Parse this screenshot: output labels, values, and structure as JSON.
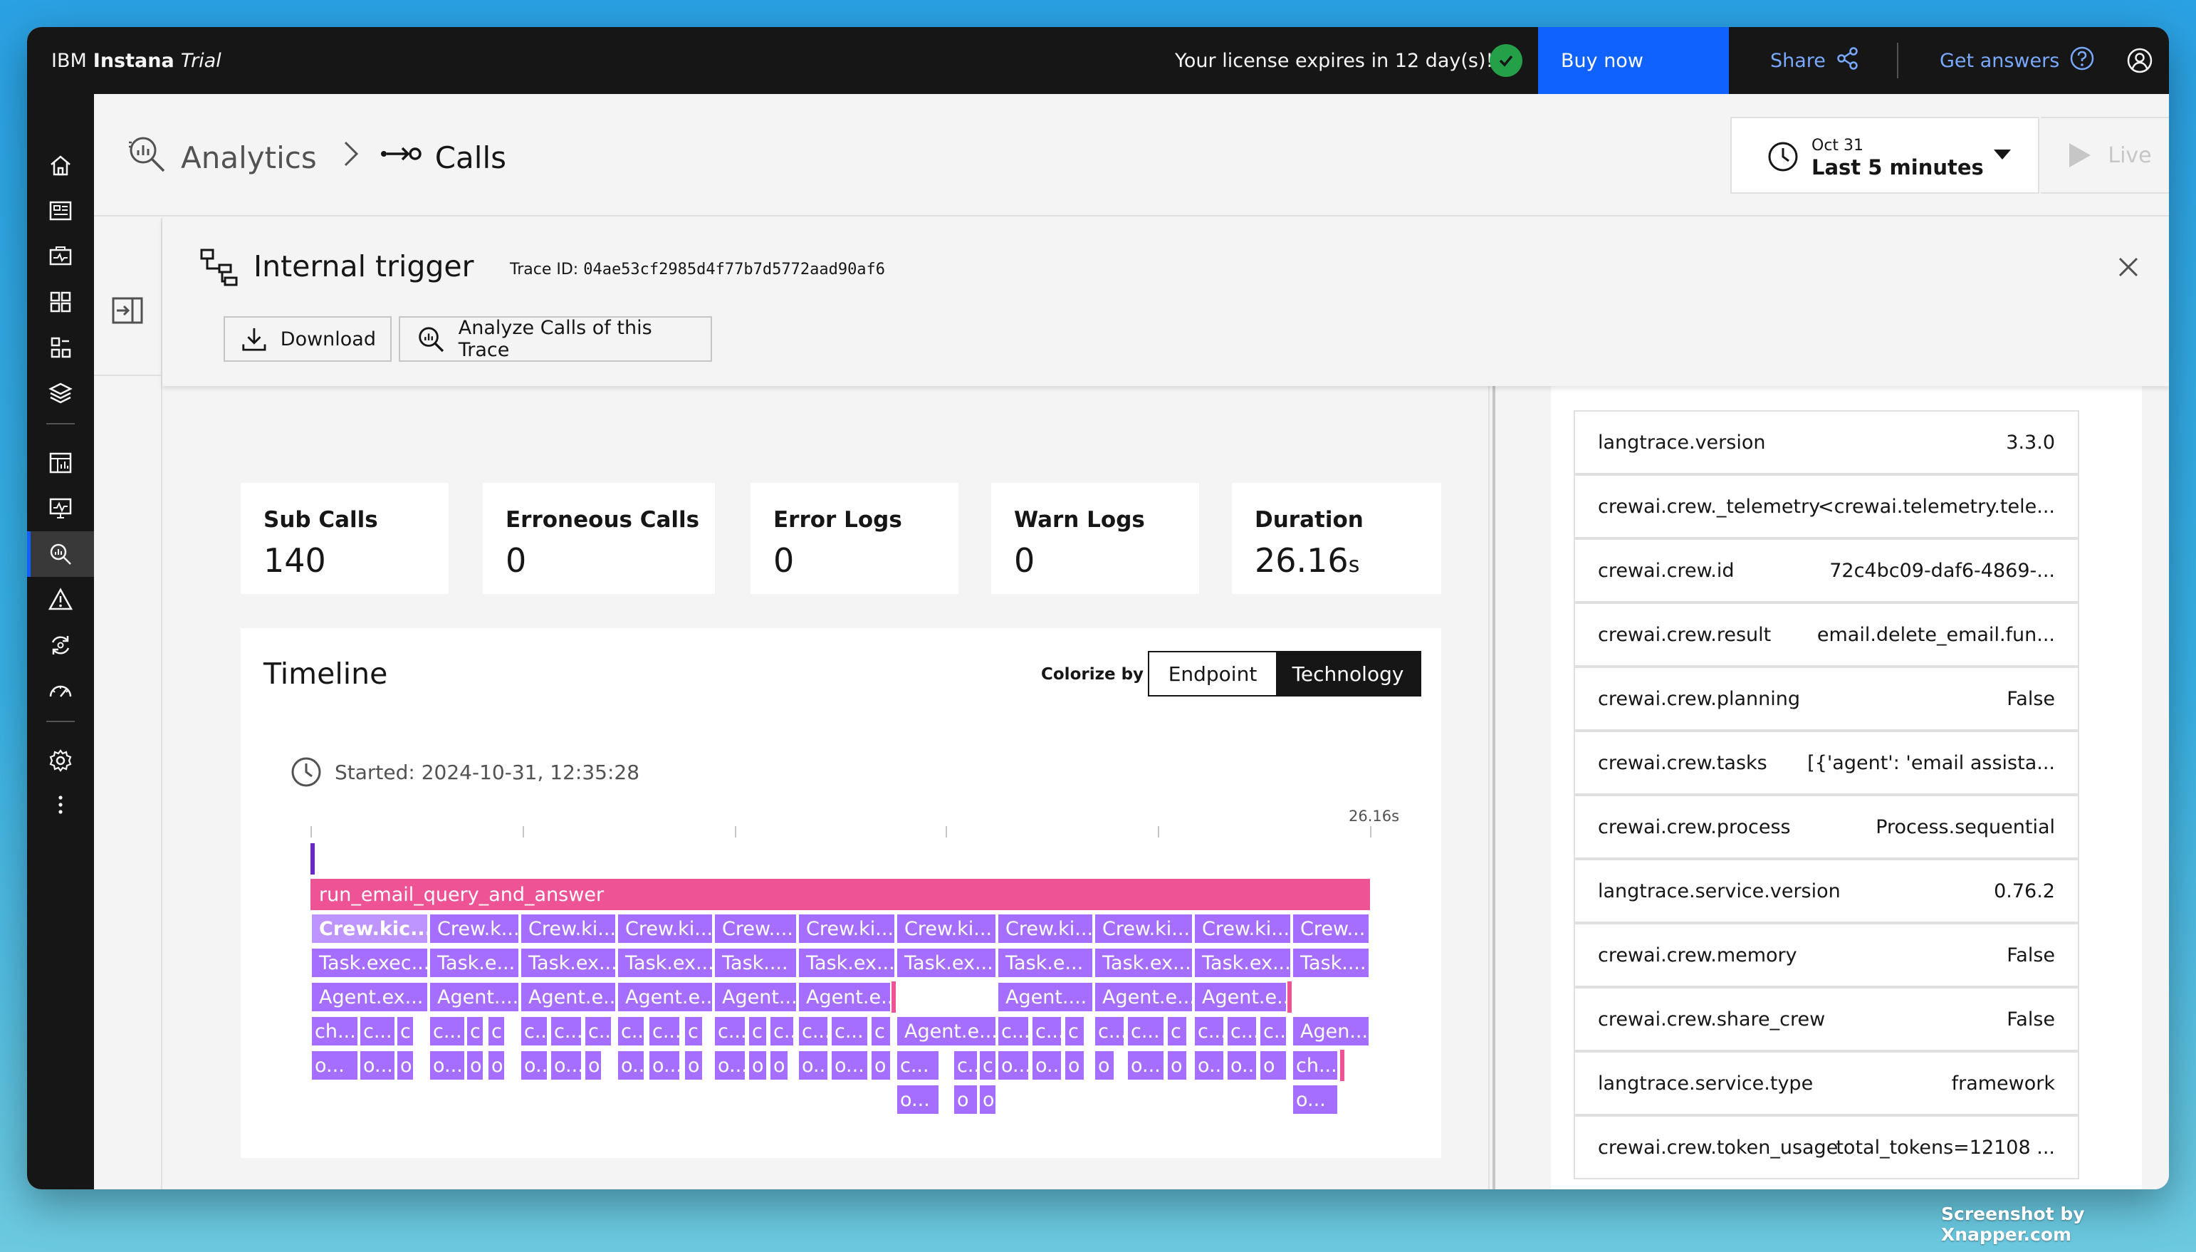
{
  "topbar": {
    "brand_ibm": "IBM",
    "brand_name": "Instana",
    "brand_trial": "Trial",
    "license_text": "Your license expires in 12 day(s)!",
    "buy_now": "Buy now",
    "share": "Share",
    "get_answers": "Get answers"
  },
  "header": {
    "breadcrumb_analytics": "Analytics",
    "breadcrumb_calls": "Calls",
    "time_date": "Oct 31",
    "time_range": "Last 5 minutes",
    "live": "Live"
  },
  "panel": {
    "title": "Internal trigger",
    "trace_label": "Trace ID:",
    "trace_id": "04ae53cf2985d4f77b7d5772aad90af6",
    "download": "Download",
    "analyze": "Analyze Calls of this Trace"
  },
  "stats": [
    {
      "label": "Sub Calls",
      "value": "140",
      "unit": ""
    },
    {
      "label": "Erroneous Calls",
      "value": "0",
      "unit": ""
    },
    {
      "label": "Error Logs",
      "value": "0",
      "unit": ""
    },
    {
      "label": "Warn Logs",
      "value": "0",
      "unit": ""
    },
    {
      "label": "Duration",
      "value": "26.16",
      "unit": "s"
    }
  ],
  "timeline": {
    "title": "Timeline",
    "colorize_by": "Colorize by",
    "opt_endpoint": "Endpoint",
    "opt_technology": "Technology",
    "started": "Started: 2024-10-31, 12:35:28",
    "end_tick": "26.16s",
    "root_span": "run_email_query_and_answer",
    "row1": [
      "Crew.kic...",
      "Crew.k...",
      "Crew.ki...",
      "Crew.ki...",
      "Crew....",
      "Crew.ki...",
      "Crew.ki...",
      "Crew.ki...",
      "Crew.ki...",
      "Crew.ki...",
      "Crew..."
    ],
    "row2": [
      "Task.exec...",
      "Task.e...",
      "Task.ex...",
      "Task.ex...",
      "Task....",
      "Task.ex...",
      "Task.ex...",
      "Task.e...",
      "Task.ex...",
      "Task.ex...",
      "Task...."
    ],
    "row3": [
      "Agent.ex...",
      "Agent....",
      "Agent.e...",
      "Agent.e...",
      "Agent....",
      "Agent.e...",
      "Agent....",
      "Agent.e...",
      "Agent.e..."
    ],
    "row4": [
      "ch...",
      "c...",
      "c",
      "c...",
      "c",
      "c",
      "c...",
      "c...",
      "c...",
      "c...",
      "c...",
      "c",
      "c...",
      "c",
      "c...",
      "c...",
      "c...",
      "c",
      "Agent.e...",
      "c...",
      "c...",
      "c",
      "c...",
      "c...",
      "c",
      "c...",
      "c...",
      "c...",
      "Agen..."
    ],
    "row5": [
      "o...",
      "o...",
      "o",
      "o...",
      "o",
      "o",
      "o...",
      "o...",
      "o",
      "o...",
      "o...",
      "o",
      "o...",
      "o",
      "o",
      "o...",
      "o...",
      "o",
      "c...",
      "c...",
      "c",
      "o...",
      "o...",
      "o",
      "o",
      "o...",
      "o",
      "o...",
      "o...",
      "o",
      "ch..."
    ],
    "row6": [
      "o...",
      "o",
      "o",
      "o..."
    ]
  },
  "attributes": [
    {
      "key": "langtrace.version",
      "value": "3.3.0"
    },
    {
      "key": "crewai.crew._telemetry",
      "value": "<crewai.telemetry.tele..."
    },
    {
      "key": "crewai.crew.id",
      "value": "72c4bc09-daf6-4869-..."
    },
    {
      "key": "crewai.crew.result",
      "value": "email.delete_email.fun..."
    },
    {
      "key": "crewai.crew.planning",
      "value": "False"
    },
    {
      "key": "crewai.crew.tasks",
      "value": "[{'agent': 'email assista..."
    },
    {
      "key": "crewai.crew.process",
      "value": "Process.sequential"
    },
    {
      "key": "langtrace.service.version",
      "value": "0.76.2"
    },
    {
      "key": "crewai.crew.memory",
      "value": "False"
    },
    {
      "key": "crewai.crew.share_crew",
      "value": "False"
    },
    {
      "key": "langtrace.service.type",
      "value": "framework"
    },
    {
      "key": "crewai.crew.token_usage",
      "value": "total_tokens=12108 ..."
    }
  ],
  "watermark": "Screenshot by Xnapper.com",
  "colors": {
    "brand_blue": "#0f62fe",
    "root_span": "#ee5396",
    "span_purple": "#a56eff",
    "topbar": "#161616"
  }
}
